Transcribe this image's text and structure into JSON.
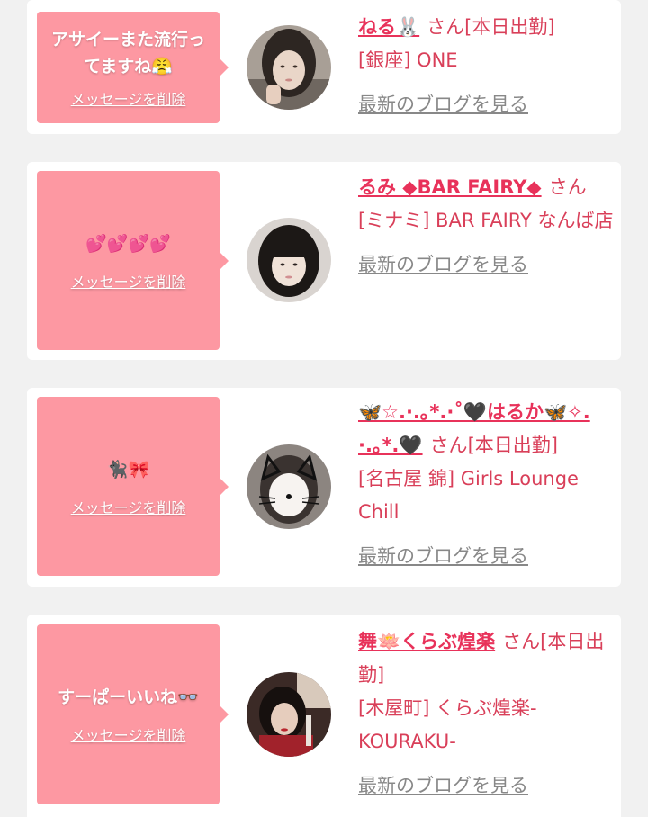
{
  "favorites": [
    {
      "message": "アサイーまた流行ってますね😤",
      "delete_label": "メッセージを削除",
      "name": "ねる🐰",
      "honorific": "さん",
      "status": "[本日出勤]",
      "area_shop": "[銀座] ONE",
      "blog_link": "最新のブログを見る"
    },
    {
      "message": "💕💕💕💕",
      "delete_label": "メッセージを削除",
      "name": "るみ ◆BAR FAIRY◆",
      "honorific": "さん",
      "status": "",
      "area_shop": "[ミナミ] BAR FAIRY なんば店",
      "blog_link": "最新のブログを見る"
    },
    {
      "message": "🐈‍⬛🎀",
      "delete_label": "メッセージを削除",
      "name": "🦋☆.·.｡*.·˚🖤はるか🦋✧.·.｡*.🖤",
      "honorific": "さん",
      "status": "[本日出勤]",
      "area_shop": "[名古屋 錦] Girls Lounge Chill",
      "blog_link": "最新のブログを見る"
    },
    {
      "message": "すーぱーいいね👓",
      "delete_label": "メッセージを削除",
      "name": "舞🪷くらぶ煌楽",
      "honorific": "さん",
      "status": "[本日出勤]",
      "area_shop": "[木屋町] くらぶ煌楽-KOURAKU-",
      "blog_link": "最新のブログを見る"
    }
  ],
  "colors": {
    "background": "#f1f1f1",
    "card": "#ffffff",
    "message_box": "#fd98a2",
    "name_link": "#e8325a",
    "shop_text": "#d93f59",
    "blog_link": "#888888"
  }
}
